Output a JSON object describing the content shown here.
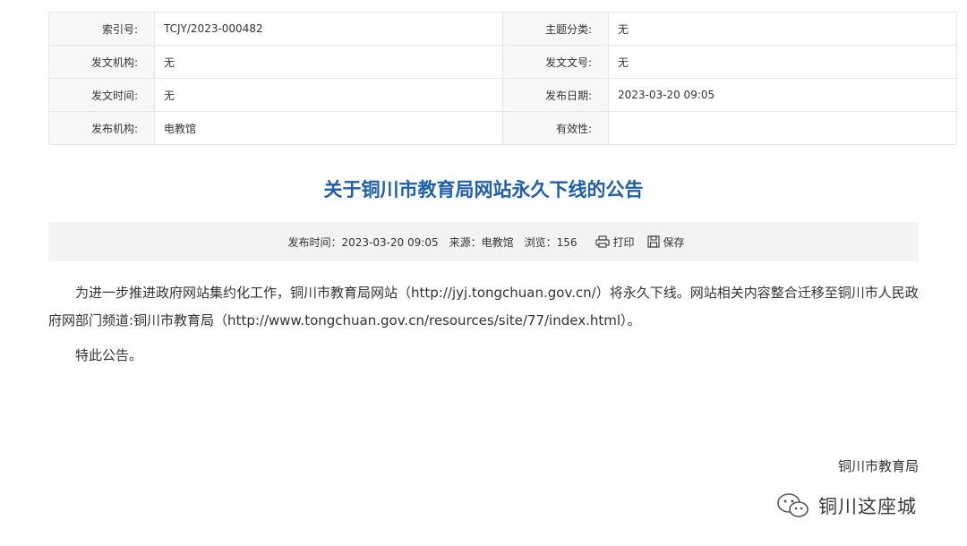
{
  "meta": {
    "rows": [
      {
        "label1": "索引号:",
        "value1": "TCJY/2023-000482",
        "label2": "主题分类:",
        "value2": "无"
      },
      {
        "label1": "发文机构:",
        "value1": "无",
        "label2": "发文文号:",
        "value2": "无"
      },
      {
        "label1": "发文时间:",
        "value1": "无",
        "label2": "发布日期:",
        "value2": "2023-03-20 09:05"
      },
      {
        "label1": "发布机构:",
        "value1": "电教馆",
        "label2": "有效性:",
        "value2": ""
      }
    ]
  },
  "article": {
    "title": "关于铜川市教育局网站永久下线的公告",
    "info": {
      "publish_time": "发布时间：2023-03-20 09:05",
      "source": "来源：电教馆",
      "views": "浏览：156",
      "print_label": "打印",
      "save_label": "保存"
    },
    "paragraphs": [
      "为进一步推进政府网站集约化工作，铜川市教育局网站（http://jyj.tongchuan.gov.cn/）将永久下线。网站相关内容整合迁移至铜川市人民政府网部门频道:铜川市教育局（http://www.tongchuan.gov.cn/resources/site/77/index.html）。",
      "特此公告。"
    ],
    "signature": "铜川市教育局"
  },
  "watermark": {
    "icon": "wechat-icon",
    "text": "铜川这座城"
  }
}
